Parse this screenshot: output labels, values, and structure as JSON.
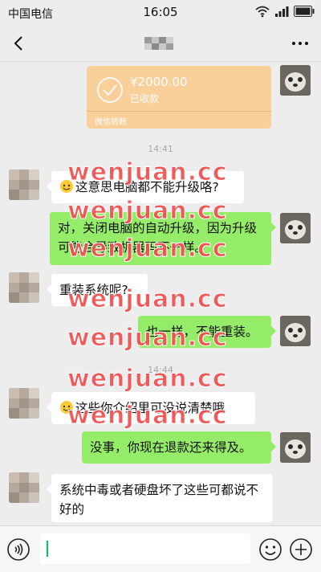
{
  "status_bar": {
    "carrier": "中国电信",
    "time": "16:05"
  },
  "nav": {
    "back_icon": "chevron-left-icon",
    "more_icon": "more-dots-icon"
  },
  "messages": {
    "transfer": {
      "amount": "¥2000.00",
      "status": "已收款",
      "footer": "微信转账"
    },
    "time1": "14:41",
    "m1": "这意思电脑都不能升级咯?",
    "m2": "对，关闭电脑的自动升级，因为升级可能会导致机器码不一样。",
    "m3": "重装系统呢?",
    "m4": "也一样，不能重装。",
    "time2": "14:44",
    "m5": "这些你介绍里可没说清楚哦",
    "m6": "没事，你现在退款还来得及。",
    "m7": "系统中毒或者硬盘坏了这些可都说不好的"
  },
  "watermark": {
    "text": "wenjuan.cc",
    "color": "#f14f4f"
  },
  "colors": {
    "outgoing_bubble": "#95ec69",
    "incoming_bubble": "#ffffff",
    "transfer_card": "#f9cf9a",
    "background": "#ededed"
  }
}
